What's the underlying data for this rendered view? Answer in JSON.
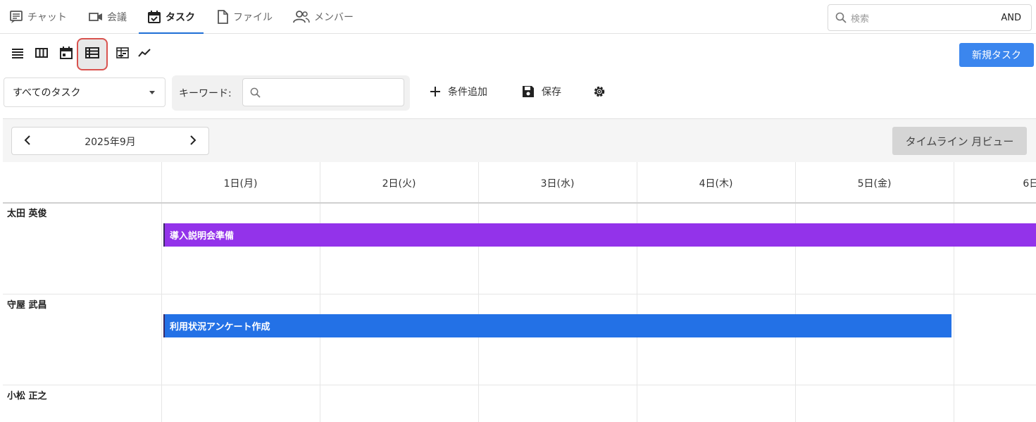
{
  "nav": {
    "tabs": [
      {
        "label": "チャット",
        "icon": "chat-icon"
      },
      {
        "label": "会議",
        "icon": "video-icon"
      },
      {
        "label": "タスク",
        "icon": "calendar-check-icon",
        "active": true
      },
      {
        "label": "ファイル",
        "icon": "file-icon"
      },
      {
        "label": "メンバー",
        "icon": "members-icon"
      }
    ],
    "search": {
      "placeholder": "検索",
      "mode": "AND"
    }
  },
  "toolbar": {
    "views": [
      "list-view-icon",
      "board-view-icon",
      "calendar-view-icon",
      "timeline-view-icon",
      "gantt-view-icon",
      "chart-view-icon"
    ],
    "selected_view": "timeline-view-icon",
    "new_task_label": "新規タスク"
  },
  "filter": {
    "task_select": "すべてのタスク",
    "keyword_label": "キーワード:",
    "keyword_value": "",
    "add_condition": "条件追加",
    "save": "保存"
  },
  "calendar": {
    "month": "2025年9月",
    "view_name": "タイムライン 月ビュー",
    "days": [
      "1日(月)",
      "2日(火)",
      "3日(水)",
      "4日(木)",
      "5日(金)",
      "6日("
    ],
    "rows": [
      {
        "name": "太田 英俊",
        "tasks": [
          {
            "title": "導入説明会準備",
            "color": "#9333ea"
          }
        ]
      },
      {
        "name": "守屋 武昌",
        "tasks": [
          {
            "title": "利用状況アンケート作成",
            "color": "#2371e6"
          }
        ]
      },
      {
        "name": "小松 正之",
        "tasks": []
      }
    ]
  },
  "colors": {
    "accent": "#1f6fd6",
    "primary_button": "#3b86ee",
    "selected_outline": "#d9534f"
  }
}
